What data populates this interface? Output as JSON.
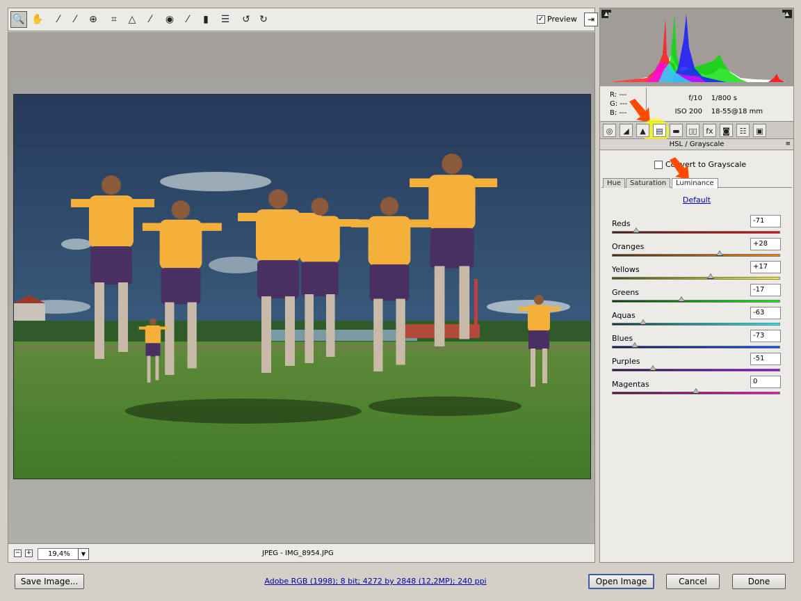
{
  "toolbar": {
    "tools": [
      {
        "name": "zoom-tool",
        "glyph": "🔍"
      },
      {
        "name": "hand-tool",
        "glyph": "✋"
      },
      {
        "name": "white-balance-tool",
        "glyph": "⁄"
      },
      {
        "name": "color-sampler-tool",
        "glyph": "⁄"
      },
      {
        "name": "targeted-adjustment-tool",
        "glyph": "⊕"
      },
      {
        "name": "crop-tool",
        "glyph": "⌗"
      },
      {
        "name": "straighten-tool",
        "glyph": "△"
      },
      {
        "name": "spot-removal-tool",
        "glyph": "⁄"
      },
      {
        "name": "red-eye-tool",
        "glyph": "◉"
      },
      {
        "name": "adjustment-brush-tool",
        "glyph": "⁄"
      },
      {
        "name": "graduated-filter-tool",
        "glyph": "▮"
      },
      {
        "name": "preferences-tool",
        "glyph": "☰"
      },
      {
        "name": "rotate-ccw-tool",
        "glyph": "↺"
      },
      {
        "name": "rotate-cw-tool",
        "glyph": "↻"
      }
    ],
    "preview_label": "Preview",
    "preview_checked": "✓",
    "fullscreen_glyph": "⇥"
  },
  "status": {
    "zoom_out": "−",
    "zoom_in": "+",
    "zoom_value": "19,4%",
    "dropdown_glyph": "▼",
    "file_label": "JPEG  -  IMG_8954.JPG"
  },
  "info": {
    "r_label": "R:",
    "r_value": "---",
    "g_label": "G:",
    "g_value": "---",
    "b_label": "B:",
    "b_value": "---",
    "aperture": "f/10",
    "shutter": "1/800 s",
    "iso": "ISO 200",
    "lens": "18-55@18 mm"
  },
  "panel": {
    "tab_icons": [
      "◎",
      "◢",
      "▲",
      "▤",
      "▬",
      "▯▯",
      "fx",
      "◙",
      "☷",
      "▣"
    ],
    "header": "HSL / Grayscale",
    "menu_glyph": "≡",
    "convert_label": "Convert to Grayscale",
    "subtabs": [
      "Hue",
      "Saturation",
      "Luminance"
    ],
    "active_subtab": "Luminance",
    "default_link": "Default",
    "sliders": [
      {
        "label": "Reds",
        "value": "-71",
        "num": -71,
        "gradient": [
          "#4a1b1b",
          "#ff0000"
        ]
      },
      {
        "label": "Oranges",
        "value": "+28",
        "num": 28,
        "gradient": [
          "#4a2b0e",
          "#ff8000"
        ]
      },
      {
        "label": "Yellows",
        "value": "+17",
        "num": 17,
        "gradient": [
          "#4a4a0e",
          "#ffff00"
        ]
      },
      {
        "label": "Greens",
        "value": "-17",
        "num": -17,
        "gradient": [
          "#0e3a0e",
          "#00ff00"
        ]
      },
      {
        "label": "Aquas",
        "value": "-63",
        "num": -63,
        "gradient": [
          "#0e3a3a",
          "#00ffff"
        ]
      },
      {
        "label": "Blues",
        "value": "-73",
        "num": -73,
        "gradient": [
          "#0e1a4a",
          "#0050ff"
        ]
      },
      {
        "label": "Purples",
        "value": "-51",
        "num": -51,
        "gradient": [
          "#2a0e4a",
          "#a000ff"
        ]
      },
      {
        "label": "Magentas",
        "value": "0",
        "num": 0,
        "gradient": [
          "#4a0e3a",
          "#ff00c0"
        ]
      }
    ]
  },
  "bottom": {
    "save_label": "Save Image...",
    "workflow": "Adobe RGB (1998); 8 bit; 4272 by 2848 (12,2MP); 240 ppi",
    "open_label": "Open Image",
    "cancel_label": "Cancel",
    "done_label": "Done"
  },
  "colors": {
    "sky": "#2d4566",
    "grass": "#4a8a2a",
    "jersey": "#f4b03a",
    "shorts": "#4a2f63",
    "highlight": "#ffff00",
    "arrow": "#ff4a00",
    "link": "#0000aa"
  }
}
